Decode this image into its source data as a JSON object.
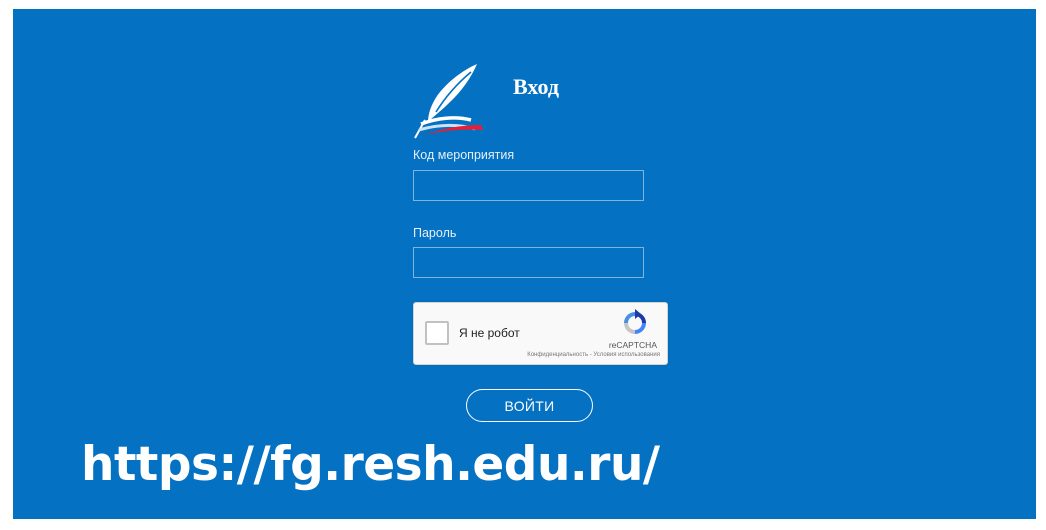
{
  "form": {
    "title": "Вход",
    "event_code_label": "Код мероприятия",
    "event_code_value": "",
    "password_label": "Пароль",
    "password_value": ""
  },
  "captcha": {
    "checkbox_label": "Я не робот",
    "brand": "reCAPTCHA",
    "terms": "Конфиденциальность - Условия использования"
  },
  "login_button": "ВОЙТИ",
  "url_caption": "https://fg.resh.edu.ru/",
  "colors": {
    "background": "#0471c2",
    "text": "#ffffff",
    "logo_red": "#e3203a"
  },
  "icons": {
    "logo": "feather-book-logo-icon",
    "recaptcha": "recaptcha-logo-icon"
  }
}
